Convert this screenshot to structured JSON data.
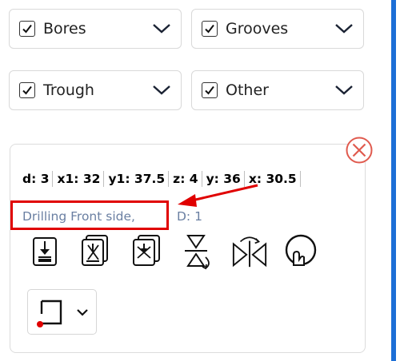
{
  "filters": [
    {
      "label": "Bores",
      "checked": true
    },
    {
      "label": "Grooves",
      "checked": true
    },
    {
      "label": "Trough",
      "checked": true
    },
    {
      "label": "Other",
      "checked": true
    }
  ],
  "item": {
    "params": [
      {
        "name": "d",
        "value": "3",
        "text": "d: 3"
      },
      {
        "name": "x1",
        "value": "32",
        "text": "x1: 32"
      },
      {
        "name": "y1",
        "value": "37.5",
        "text": "y1: 37.5"
      },
      {
        "name": "z",
        "value": "4",
        "text": "z: 4"
      },
      {
        "name": "y",
        "value": "36",
        "text": "y: 36"
      },
      {
        "name": "x",
        "value": "30.5",
        "text": "x: 30.5"
      }
    ],
    "operation": "Drilling Front side,",
    "operation_extra": "D: 1"
  },
  "tools": [
    {
      "icon": "drill-front-icon"
    },
    {
      "icon": "drill-stack-cross-icon"
    },
    {
      "icon": "drill-stack-x-icon"
    },
    {
      "icon": "flip-vertical-icon"
    },
    {
      "icon": "mirror-horizontal-icon"
    },
    {
      "icon": "touch-select-icon"
    }
  ],
  "colors": {
    "highlight": "#e00000",
    "accent": "#1c6fd6",
    "close": "#e05a4e",
    "operation_text": "#6a7fa2"
  }
}
